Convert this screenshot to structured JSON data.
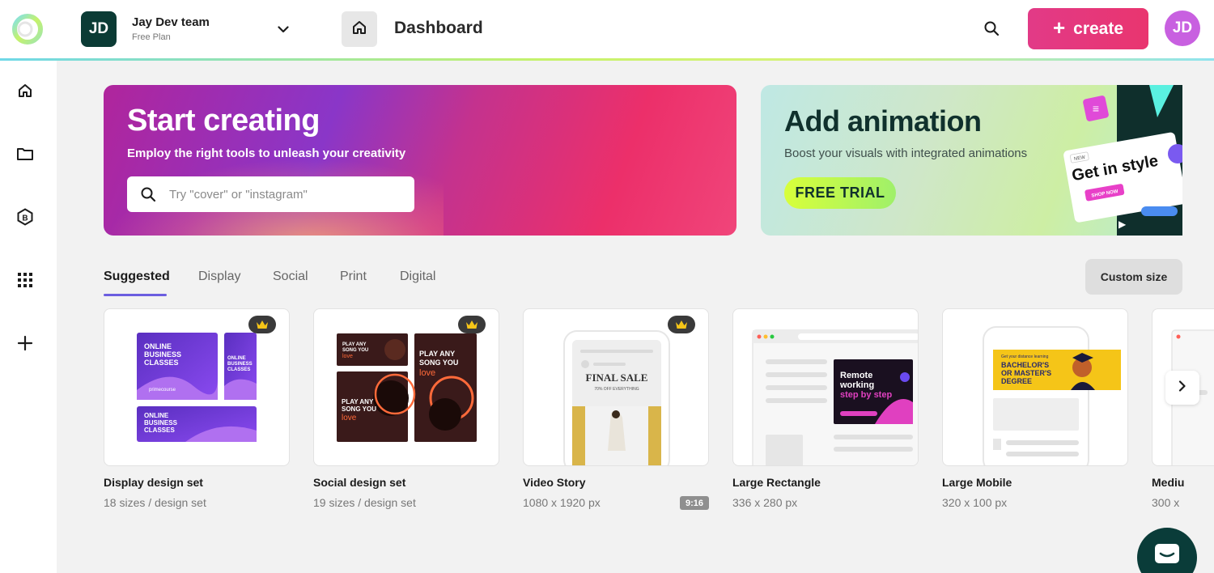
{
  "header": {
    "team_initials": "JD",
    "team_name": "Jay Dev team",
    "team_plan": "Free Plan",
    "page_title": "Dashboard",
    "create_label": "create",
    "user_initials": "JD"
  },
  "hero": {
    "title": "Start creating",
    "subtitle": "Employ the right tools to unleash your creativity",
    "search_placeholder": "Try \"cover\" or \"instagram\""
  },
  "promo": {
    "title": "Add animation",
    "subtitle": "Boost your visuals with integrated animations",
    "button_label": "FREE TRIAL",
    "art_badge": "NEW",
    "art_title": "Get in style",
    "art_button": "SHOP NOW"
  },
  "tabs": [
    {
      "label": "Suggested",
      "active": true
    },
    {
      "label": "Display",
      "active": false
    },
    {
      "label": "Social",
      "active": false
    },
    {
      "label": "Print",
      "active": false
    },
    {
      "label": "Digital",
      "active": false
    }
  ],
  "custom_size_label": "Custom size",
  "cards": [
    {
      "title": "Display design set",
      "subtitle": "18 sizes / design set",
      "premium": true
    },
    {
      "title": "Social design set",
      "subtitle": "19 sizes / design set",
      "premium": true
    },
    {
      "title": "Video Story",
      "subtitle": "1080 x 1920 px",
      "premium": true,
      "badge": "9:16"
    },
    {
      "title": "Large Rectangle",
      "subtitle": "336 x 280 px",
      "premium": false
    },
    {
      "title": "Large Mobile",
      "subtitle": "320 x 100 px",
      "premium": false
    },
    {
      "title": "Mediu",
      "subtitle": "300 x",
      "premium": false
    }
  ],
  "thumbs": {
    "display": {
      "line1": "ONLINE",
      "line2": "BUSINESS",
      "line3": "CLASSES",
      "brand": "primecourse"
    },
    "social": {
      "l1": "PLAY ANY",
      "l2": "SONG YOU",
      "l3": "love"
    },
    "video": {
      "title": "FINAL SALE",
      "sub": "70% OFF EVERYTHING"
    },
    "rect": {
      "l1": "Remote",
      "l2": "working",
      "l3": "step by step"
    },
    "mobile": {
      "l1": "BACHELOR'S",
      "l2": "OR MASTER'S",
      "l3": "DEGREE",
      "small": "Get your distance learning"
    }
  },
  "colors": {
    "accent": "#6b5ee0",
    "create": "#e23a87",
    "team_avatar": "#0b3b35",
    "user_avatar": "#c860e0"
  }
}
